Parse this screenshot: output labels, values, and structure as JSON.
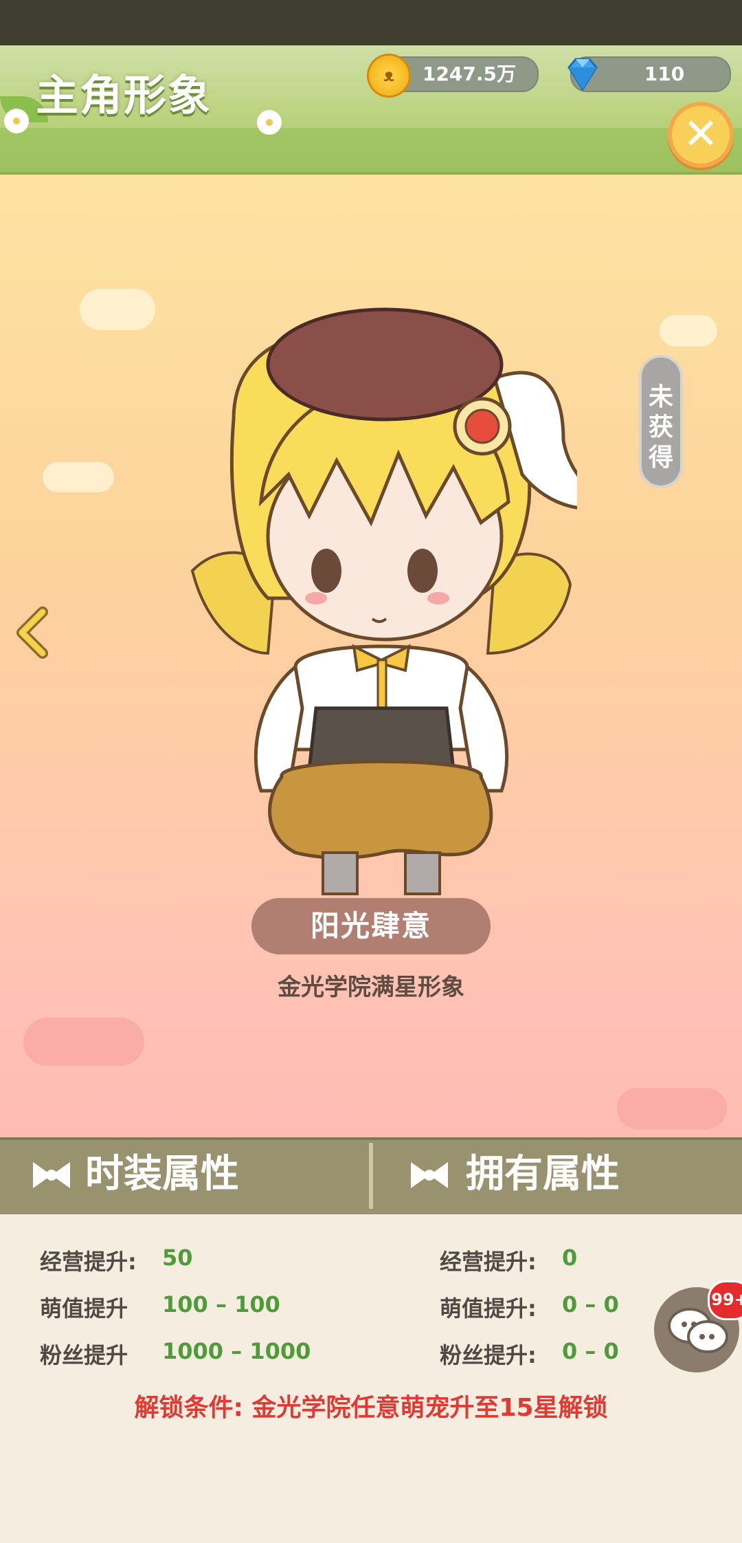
{
  "header": {
    "title": "主角形象",
    "coins": "1247.5万",
    "gems": "110",
    "close_label": "✕"
  },
  "character": {
    "status_badge": [
      "未",
      "获",
      "得"
    ],
    "name": "阳光肆意",
    "subtitle": "金光学院满星形象"
  },
  "attributes": {
    "left_title": "时装属性",
    "right_title": "拥有属性",
    "left_stats": [
      {
        "label": "经营提升:",
        "value": "50"
      },
      {
        "label": "萌值提升",
        "value": "100 – 100"
      },
      {
        "label": "粉丝提升",
        "value": "1000 – 1000"
      }
    ],
    "right_stats": [
      {
        "label": "经营提升:",
        "value": "0"
      },
      {
        "label": "萌值提升:",
        "value": "0 – 0"
      },
      {
        "label": "粉丝提升:",
        "value": "0 – 0"
      }
    ],
    "unlock_condition": "解锁条件: 金光学院任意萌宠升至15星解锁"
  },
  "chat": {
    "badge": "99+"
  },
  "colors": {
    "header_green": "#bcd37f",
    "attr_bar": "#98926f",
    "stat_green": "#4e9b3a",
    "unlock_red": "#e23a33",
    "name_pill": "#b17f72"
  }
}
